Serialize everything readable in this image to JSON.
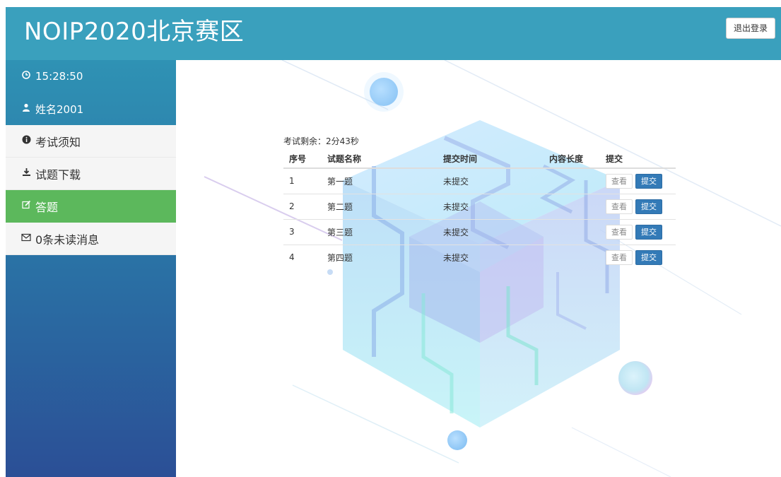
{
  "header": {
    "title": "NOIP2020北京赛区",
    "logout_label": "退出登录",
    "bg_color": "#3aa0bd"
  },
  "sidebar": {
    "clock_icon": "clock-icon",
    "time": "15:28:50",
    "user_icon": "user-icon",
    "username": "姓名2001",
    "items": [
      {
        "icon": "info-circle-icon",
        "label": "考试须知"
      },
      {
        "icon": "download-icon",
        "label": "试题下载"
      },
      {
        "icon": "edit-icon",
        "label": "答题",
        "active": true
      },
      {
        "icon": "envelope-icon",
        "label": "0条未读消息"
      }
    ],
    "active_color": "#5cb85c"
  },
  "exam": {
    "remaining": "考试剩余：2分43秒",
    "columns": [
      "序号",
      "试题名称",
      "提交时间",
      "内容长度",
      "提交"
    ],
    "rows": [
      {
        "no": "1",
        "name": "第一题",
        "time": "未提交",
        "length": "",
        "view": "查看",
        "submit": "提交"
      },
      {
        "no": "2",
        "name": "第二题",
        "time": "未提交",
        "length": "",
        "view": "查看",
        "submit": "提交"
      },
      {
        "no": "3",
        "name": "第三题",
        "time": "未提交",
        "length": "",
        "view": "查看",
        "submit": "提交"
      },
      {
        "no": "4",
        "name": "第四题",
        "time": "未提交",
        "length": "",
        "view": "查看",
        "submit": "提交"
      }
    ]
  },
  "colors": {
    "submit_button": "#337ab7",
    "sidebar_top": "#2f92b4",
    "sidebar_bottom": "#2b4f96"
  }
}
